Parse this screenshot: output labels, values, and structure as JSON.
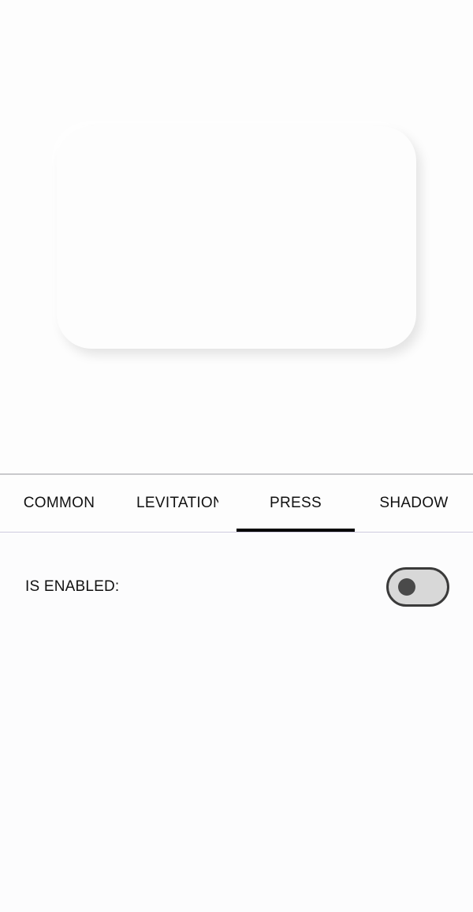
{
  "tabs": [
    {
      "label": "COMMON",
      "active": false
    },
    {
      "label": "LEVITATION",
      "active": false
    },
    {
      "label": "PRESS",
      "active": true
    },
    {
      "label": "SHADOW",
      "active": false
    }
  ],
  "settings": {
    "enabled_label": "IS ENABLED:",
    "enabled_value": false
  },
  "colors": {
    "background": "#fdfdfd",
    "tab_indicator": "#000000",
    "toggle_track": "#d8d8d8",
    "toggle_border": "#3a3a3a",
    "toggle_knob": "#4a4a4a"
  }
}
